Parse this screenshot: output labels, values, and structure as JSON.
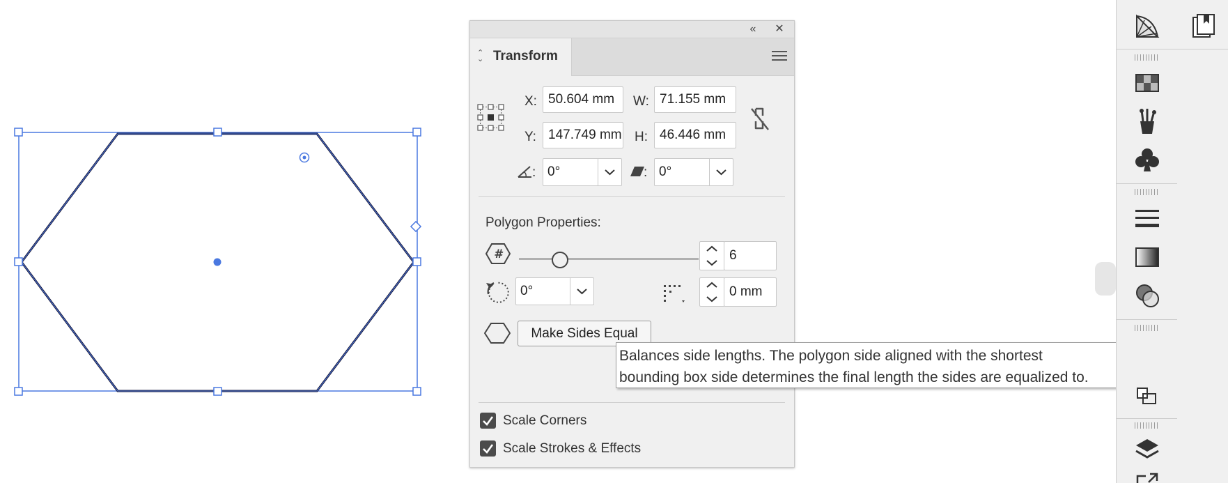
{
  "panel": {
    "title": "Transform",
    "x_label": "X:",
    "x_value": "50.604 mm",
    "y_label": "Y:",
    "y_value": "147.749 mm",
    "w_label": "W:",
    "w_value": "71.155 mm",
    "h_label": "H:",
    "h_value": "46.446 mm",
    "angle_label": ":",
    "angle_value": "0°",
    "shear_label": ":",
    "shear_value": "0°",
    "polygon_header": "Polygon Properties:",
    "sides_count": "6",
    "sides_slider_fraction": 0.2,
    "rotation_value": "0°",
    "corner_radius_value": "0 mm",
    "make_sides_equal_label": "Make Sides Equal",
    "scale_corners_label": "Scale Corners",
    "scale_corners_checked": true,
    "scale_strokes_label": "Scale Strokes & Effects",
    "scale_strokes_checked": true
  },
  "tooltip": {
    "line1": "Balances side lengths. The polygon side aligned with the shortest",
    "line2": "bounding box side determines the final length the sides are equalized to."
  },
  "dock": {
    "icons": [
      "symbol-sprayer-icon",
      "swatches-icon",
      "brushes-icon",
      "symbols-icon",
      "stroke-icon",
      "gradient-icon",
      "transparency-icon",
      "transform-icon",
      "layers-icon",
      "export-icon"
    ],
    "secondary_icon": "libraries-icon"
  },
  "colors": {
    "selection": "#4a78e0",
    "panel_bg": "#f0f0f0"
  }
}
